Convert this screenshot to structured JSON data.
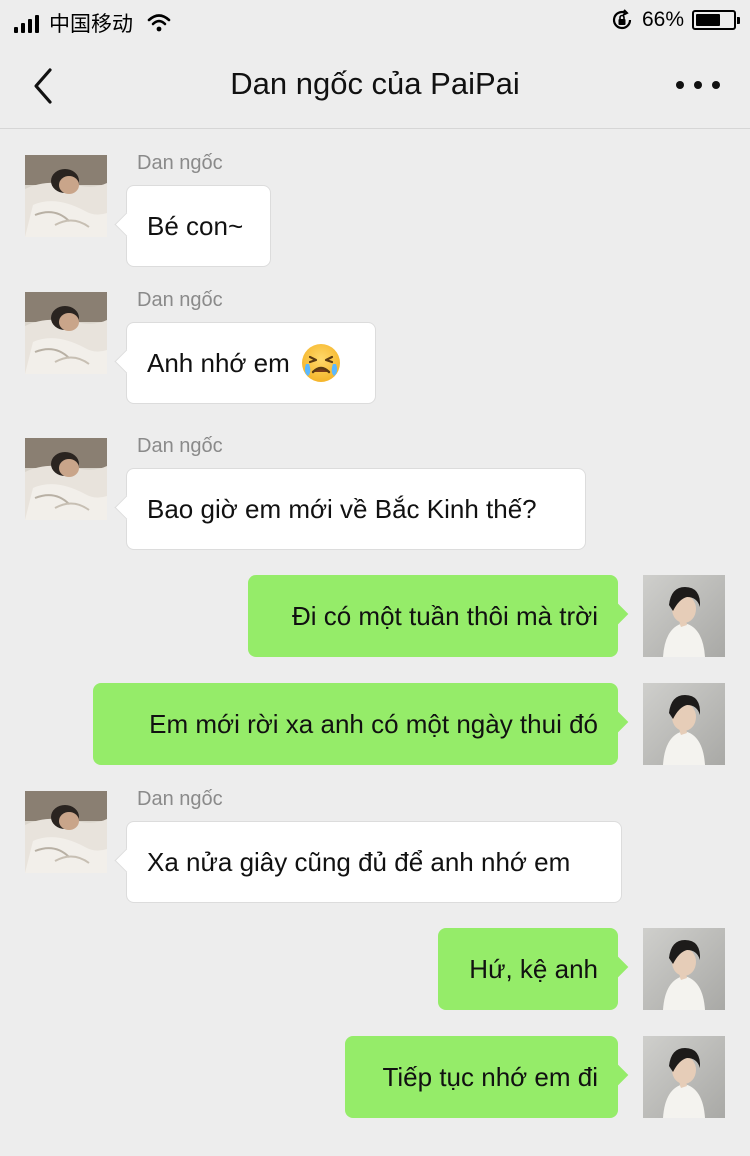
{
  "status_bar": {
    "carrier": "中国移动",
    "battery_percent": "66%",
    "battery_level": 0.66,
    "icons": [
      "signal-icon",
      "wifi-icon",
      "rotation-lock-icon",
      "battery-icon"
    ]
  },
  "nav": {
    "title": "Dan ngốc của PaiPai",
    "back_icon": "chevron-left-icon",
    "more_icon": "more-icon"
  },
  "messages": [
    {
      "side": "in",
      "sender": "Dan ngốc",
      "text": "Bé con~"
    },
    {
      "side": "in",
      "sender": "Dan ngốc",
      "text": "Anh nhớ em",
      "emoji": "crying-face-emoji"
    },
    {
      "side": "in",
      "sender": "Dan ngốc",
      "text": "Bao giờ em mới về Bắc Kinh thế?"
    },
    {
      "side": "out",
      "text": "Đi có một tuần thôi mà trời"
    },
    {
      "side": "out",
      "text": "Em mới rời xa anh có một ngày thui đó"
    },
    {
      "side": "in",
      "sender": "Dan ngốc",
      "text": "Xa nửa giây cũng đủ để anh nhớ em"
    },
    {
      "side": "out",
      "text": "Hứ, kệ anh"
    },
    {
      "side": "out",
      "text": "Tiếp tục nhớ em đi"
    }
  ]
}
